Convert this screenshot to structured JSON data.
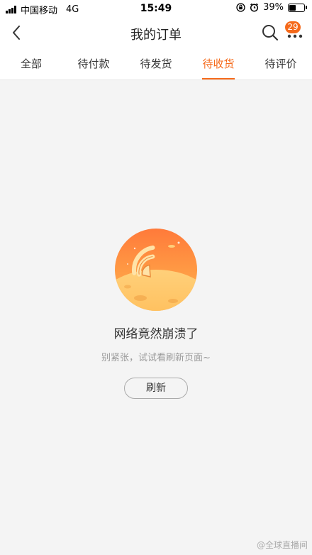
{
  "status_bar": {
    "carrier": "中国移动",
    "network": "4G",
    "time": "15:49",
    "battery": "39%",
    "battery_level": 0.39
  },
  "header": {
    "title": "我的订单",
    "badge_count": "29"
  },
  "tabs": [
    {
      "label": "全部",
      "active": false
    },
    {
      "label": "待付款",
      "active": false
    },
    {
      "label": "待发货",
      "active": false
    },
    {
      "label": "待收货",
      "active": true
    },
    {
      "label": "待评价",
      "active": false
    }
  ],
  "empty_state": {
    "title": "网络竟然崩溃了",
    "subtitle": "别紧张，试试看刷新页面~",
    "refresh_label": "刷新"
  },
  "watermark": "@全球直播间",
  "colors": {
    "accent": "#f56a1b",
    "background": "#f4f4f4"
  },
  "icons": [
    "back-icon",
    "search-icon",
    "more-icon",
    "signal-icon",
    "battery-icon",
    "alarm-icon",
    "lock-rotation-icon",
    "wifi-broken-planet-illustration"
  ]
}
